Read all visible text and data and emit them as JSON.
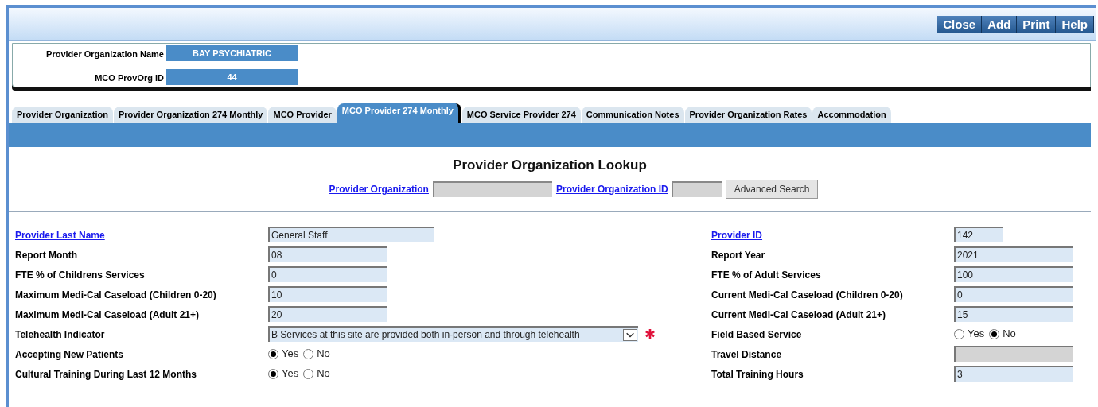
{
  "toolbar": {
    "buttons": [
      "Close",
      "Add",
      "Print",
      "Help"
    ]
  },
  "header": {
    "fields": [
      {
        "label": "Provider Organization Name",
        "value": "BAY PSYCHIATRIC"
      },
      {
        "label": "MCO ProvOrg ID",
        "value": "44"
      }
    ]
  },
  "tabs": [
    {
      "label": "Provider Organization",
      "selected": false
    },
    {
      "label": "Provider Organization 274 Monthly",
      "selected": false
    },
    {
      "label": "MCO Provider",
      "selected": false
    },
    {
      "label": "MCO Provider 274 Monthly",
      "selected": true
    },
    {
      "label": "MCO Service Provider 274",
      "selected": false
    },
    {
      "label": "Communication Notes",
      "selected": false
    },
    {
      "label": "Provider Organization Rates",
      "selected": false
    },
    {
      "label": "Accommodation",
      "selected": false
    }
  ],
  "lookup": {
    "title": "Provider Organization Lookup",
    "fields": [
      {
        "label": "Provider Organization",
        "wide": true
      },
      {
        "label": "Provider Organization ID",
        "wide": false
      }
    ],
    "button": "Advanced Search"
  },
  "rows": [
    {
      "left": {
        "label": "Provider Last Name",
        "link": true,
        "kind": "text",
        "value": "General Staff",
        "wide": true
      },
      "right": {
        "label": "Provider ID",
        "link": true,
        "kind": "text",
        "value": "142",
        "wide": false
      }
    },
    {
      "left": {
        "label": "Report Month",
        "link": false,
        "kind": "text",
        "value": "08"
      },
      "right": {
        "label": "Report Year",
        "link": false,
        "kind": "text",
        "value": "2021"
      }
    },
    {
      "left": {
        "label": "FTE % of Childrens Services",
        "link": false,
        "kind": "text",
        "value": "0"
      },
      "right": {
        "label": "FTE % of Adult Services",
        "link": false,
        "kind": "text",
        "value": "100"
      }
    },
    {
      "left": {
        "label": "Maximum Medi-Cal Caseload (Children 0-20)",
        "link": false,
        "kind": "text",
        "value": "10"
      },
      "right": {
        "label": "Current Medi-Cal Caseload (Children 0-20)",
        "link": false,
        "kind": "text",
        "value": "0"
      }
    },
    {
      "left": {
        "label": "Maximum Medi-Cal Caseload (Adult 21+)",
        "link": false,
        "kind": "text",
        "value": "20"
      },
      "right": {
        "label": "Current Medi-Cal Caseload (Adult 21+)",
        "link": false,
        "kind": "text",
        "value": "15"
      }
    },
    {
      "left": {
        "label": "Telehealth Indicator",
        "link": false,
        "kind": "select",
        "value": "B Services at this site are provided both in-person and through telehealth",
        "required": true
      },
      "right": {
        "label": "Field Based Service",
        "link": false,
        "kind": "radio",
        "options": [
          {
            "label": "Yes",
            "selected": false
          },
          {
            "label": "No",
            "selected": true
          }
        ]
      }
    },
    {
      "left": {
        "label": "Accepting New Patients",
        "link": false,
        "kind": "radio",
        "options": [
          {
            "label": "Yes",
            "selected": true
          },
          {
            "label": "No",
            "selected": false
          }
        ]
      },
      "right": {
        "label": "Travel Distance",
        "link": false,
        "kind": "text",
        "disabled": true
      }
    },
    {
      "left": {
        "label": "Cultural Training During Last 12 Months",
        "link": false,
        "kind": "radio",
        "options": [
          {
            "label": "Yes",
            "selected": true
          },
          {
            "label": "No",
            "selected": false
          }
        ]
      },
      "right": {
        "label": "Total Training Hours",
        "link": false,
        "kind": "text",
        "value": "3"
      }
    }
  ]
}
